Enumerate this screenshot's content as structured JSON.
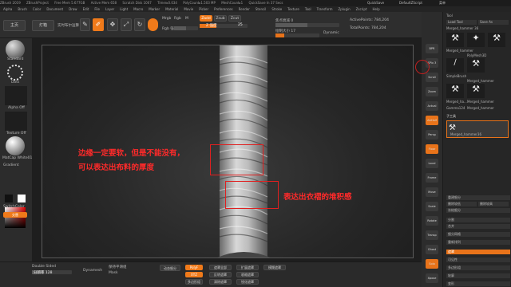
{
  "titlebar": {
    "app": "ZBrush 2019",
    "project": "ZBrushProject",
    "free_mem": "Free Mem 5.677GB",
    "active_mem": "Active Mem 658",
    "scratch": "Scratch Disk 1007",
    "timer": "Timer▸0.034",
    "polycount": "PolyCount▸1.503 MP",
    "meshcount": "MeshCount▸1",
    "quicksave": "QuickSave In 37 Secs",
    "quicksave_btn": "QuickSave",
    "default_script": "DefaultZScript",
    "menus_btn": "菜单"
  },
  "menubar": [
    "Alpha",
    "Brush",
    "Color",
    "Document",
    "Draw",
    "Edit",
    "File",
    "Layer",
    "Light",
    "Macro",
    "Marker",
    "Material",
    "Movie",
    "Picker",
    "Preferences",
    "Render",
    "Stencil",
    "Stroke",
    "Texture",
    "Tool",
    "Transform",
    "Zplugin",
    "Zscript",
    "Help"
  ],
  "shelf": {
    "home": "主页",
    "lightbox": "灯箱",
    "live_boolean": "实时布尔运算",
    "edit": "Edit",
    "draw": "Draw",
    "move": "Move",
    "scale": "Scale",
    "rotate": "Rotate",
    "mrgb": "Mrgb",
    "rgb": "Rgb",
    "m": "M",
    "rgb_intensity": "Rgb 强度",
    "zadd": "Zadd",
    "zsub": "Zsub",
    "zcut": "Zcut",
    "z_intensity": "Z 强度",
    "z_intensity_val": "25",
    "focal_shift": "焦点衰减 0",
    "draw_size": "绘制大小 17",
    "dynamic": "Dynamic",
    "active_points": "ActivePoints: 784,204",
    "total_points": "TotalPoints: 784,204"
  },
  "left_tray": {
    "brush_label": "Standard",
    "stroke_label": "Dots",
    "alpha_label": "Alpha Off",
    "texture_label": "Texture Off",
    "material_label": "MatCap White01",
    "gradient": "Gradient",
    "switch_color": "SwitchColor",
    "alternate": "交替"
  },
  "annotations": {
    "note1_line1": "边缘一定要软，但是不能没有，",
    "note1_line2": "可以表达出布料的厚度",
    "note2": "表达出衣褶的堆积感"
  },
  "bottom_tray": {
    "label1": "Double Sided",
    "label2": "Dynamesh",
    "resolution": "分辨率 128",
    "smooth_groups": "保持平滑组",
    "mask_label": "Mask",
    "dynamic_subdiv": "动态细分",
    "poly_f": "PolyF",
    "xyz": "XYZ",
    "btn_a": "多边形组",
    "btn_b": "遮罩全部",
    "btn_c": "反转遮罩",
    "btn_d": "清除遮罩",
    "btn_e": "扩展遮罩",
    "btn_f": "收缩遮罩",
    "btn_g": "锐化遮罩",
    "btn_h": "模糊遮罩"
  },
  "right_strip": {
    "items": [
      "BPR",
      "SPix 3",
      "Scroll",
      "Zoom",
      "Actual",
      "AAHalf",
      "Persp",
      "Floor",
      "Local",
      "Frame",
      "Move",
      "Scale",
      "Rotate",
      "Transp",
      "Ghost",
      "Solo",
      "Xpose"
    ]
  },
  "right_panel": {
    "header1": "Tool",
    "header2": "Load Tool",
    "header3": "Save As",
    "subtool_label": "Merged_hammer 36",
    "tools": [
      "Merged_hammer",
      "PolyMesh3D",
      "SimpleBrush",
      "Merged_hammer",
      "Merged_ha...",
      "Merged_hammer",
      "Gamma124",
      "Merged_hammer",
      "Merged_hammer Merged_hammer"
    ],
    "subtool_section": "子工具",
    "subtool_item": "Merged_hammer36",
    "rows": [
      "重建细分",
      "删除较低",
      "删除较高",
      "冻结细分",
      "分割",
      "合并",
      "细分网格",
      "重新排列",
      "遮罩",
      "可见性",
      "多边形组",
      "轮廓",
      "变形"
    ]
  },
  "colors": {
    "accent": "#f07a1a",
    "annotation": "#ff2a2a"
  }
}
